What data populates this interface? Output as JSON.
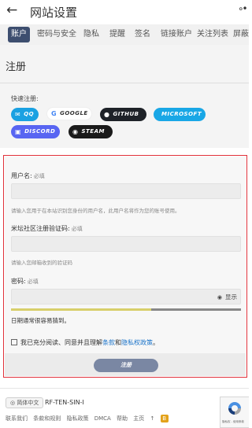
{
  "header": {
    "back_icon": "←",
    "title": "网站设置",
    "more_icon": "∘•"
  },
  "tabs": [
    {
      "label": "账户",
      "active": true
    },
    {
      "label": "密码与安全"
    },
    {
      "label": "隐私"
    },
    {
      "label": "提醒"
    },
    {
      "label": "签名"
    },
    {
      "label": "链接账户"
    },
    {
      "label": "关注列表"
    },
    {
      "label": "屏蔽"
    }
  ],
  "register": {
    "title": "注册",
    "quick_label": "快速注册:",
    "oauth": [
      {
        "label": "QQ",
        "icon": "mail-icon",
        "color": "#1aa1e2",
        "text_color": "#ffffff"
      },
      {
        "label": "GOOGLE",
        "icon": "google-icon",
        "color": "#ffffff",
        "text_color": "#333333"
      },
      {
        "label": "GITHUB",
        "icon": "github-icon",
        "color": "#1e2228",
        "text_color": "#ffffff"
      },
      {
        "label": "MICROSOFT",
        "icon": "microsoft-icon",
        "color": "#19a7e6",
        "text_color": "#ffffff"
      },
      {
        "label": "DISCORD",
        "icon": "discord-icon",
        "color": "#5865f2",
        "text_color": "#ffffff"
      },
      {
        "label": "STEAM",
        "icon": "steam-icon",
        "color": "#1a1a1a",
        "text_color": "#ffffff"
      }
    ]
  },
  "form": {
    "username_label": "用户名:",
    "username_required": "必填",
    "username_help": "请输入您用于在本站识别您身份的用户名，此用户名将作为您的账号使用。",
    "code_label": "米坛社区注册验证码:",
    "code_required": "必填",
    "code_help": "请输入您邮箱收到的验证码",
    "password_label": "密码:",
    "password_required": "必填",
    "show_icon": "eye-icon",
    "show_label": "显示",
    "strength_value": 0.61,
    "strength_text": "日期通常很容易猜到。",
    "agree_prefix": "我已充分阅读、同意并且理解",
    "agree_terms": "条款",
    "agree_and": "和",
    "agree_privacy": "隐私权政策",
    "agree_suffix": "。",
    "submit_label": "注册"
  },
  "footer": {
    "language": "简体中文",
    "site_code": "RF-TEN-SIN-I",
    "links": [
      "联系我们",
      "条款和规则",
      "隐私政策",
      "DMCA",
      "帮助",
      "主页",
      "↑"
    ],
    "badge": "B",
    "captcha_text": "隐私权 - 使用条款"
  }
}
